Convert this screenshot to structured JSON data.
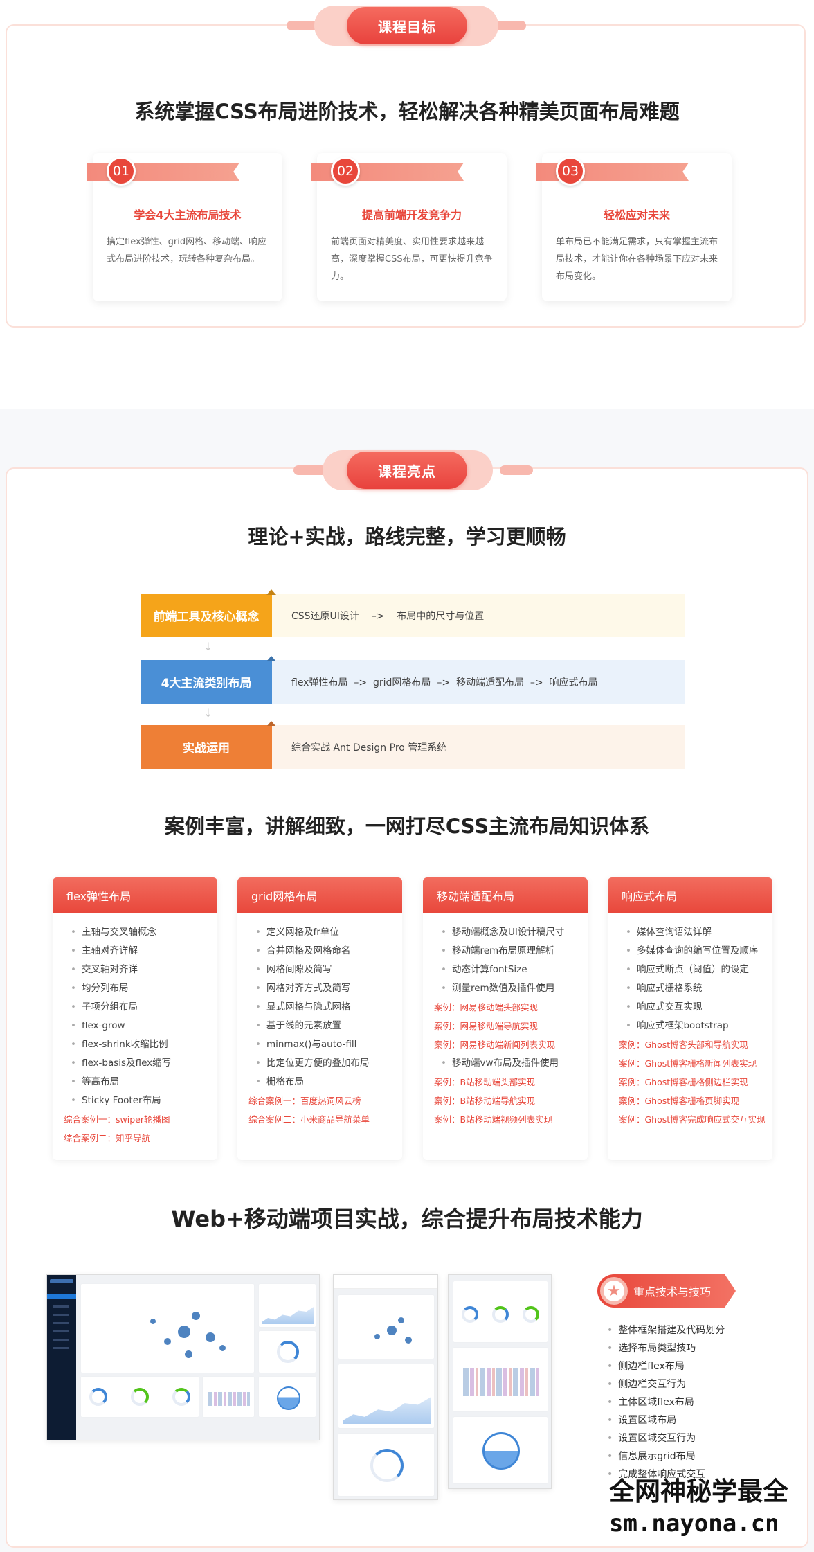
{
  "section1": {
    "badge": "课程目标",
    "heading": "系统掌握CSS布局进阶技术，轻松解决各种精美页面布局难题",
    "goals": [
      {
        "num": "01",
        "title": "学会4大主流布局技术",
        "desc": "搞定flex弹性、grid网格、移动端、响应式布局进阶技术，玩转各种复杂布局。"
      },
      {
        "num": "02",
        "title": "提高前端开发竞争力",
        "desc": "前端页面对精美度、实用性要求越来越高，深度掌握CSS布局，可更快提升竞争力。"
      },
      {
        "num": "03",
        "title": "轻松应对未来",
        "desc": "单布局已不能满足需求，只有掌握主流布局技术，才能让你在各种场景下应对未来布局变化。"
      }
    ]
  },
  "section2": {
    "badge": "课程亮点",
    "heading1": "理论+实战，路线完整，学习更顺畅",
    "route": [
      {
        "label": "前端工具及核心概念",
        "content": "CSS还原UI设计    –>    布局中的尺寸与位置",
        "color": "#f5a41a",
        "bg": "#fef9e9"
      },
      {
        "label": "4大主流类别布局",
        "content": "flex弹性布局  –>  grid网格布局  –>  移动端适配布局  –>  响应式布局",
        "color": "#4a8fd6",
        "bg": "#eaf2fb"
      },
      {
        "label": "实战运用",
        "content": "综合实战 Ant Design Pro 管理系统",
        "color": "#ee7f36",
        "bg": "#fdf3ea"
      }
    ],
    "arrow": "↓",
    "heading2": "案例丰富，讲解细致，一网打尽CSS主流布局知识体系",
    "cases": [
      {
        "title": "flex弹性布局",
        "items": [
          {
            "t": "主轴与交叉轴概念",
            "s": false
          },
          {
            "t": "主轴对齐详解",
            "s": false
          },
          {
            "t": "交叉轴对齐详",
            "s": false
          },
          {
            "t": "均分列布局",
            "s": false
          },
          {
            "t": "子项分组布局",
            "s": false
          },
          {
            "t": "flex-grow",
            "s": false
          },
          {
            "t": "flex-shrink收缩比例",
            "s": false
          },
          {
            "t": "flex-basis及flex缩写",
            "s": false
          },
          {
            "t": "等高布局",
            "s": false
          },
          {
            "t": "Sticky Footer布局",
            "s": false
          },
          {
            "t": "综合案例一：swiper轮播图",
            "s": true
          },
          {
            "t": "综合案例二：知乎导航",
            "s": true
          }
        ]
      },
      {
        "title": "grid网格布局",
        "items": [
          {
            "t": "定义网格及fr单位",
            "s": false
          },
          {
            "t": "合并网格及网格命名",
            "s": false
          },
          {
            "t": "网格间隙及简写",
            "s": false
          },
          {
            "t": "网格对齐方式及简写",
            "s": false
          },
          {
            "t": "显式网格与隐式网格",
            "s": false
          },
          {
            "t": "基于线的元素放置",
            "s": false
          },
          {
            "t": "minmax()与auto-fill",
            "s": false
          },
          {
            "t": "比定位更方便的叠加布局",
            "s": false
          },
          {
            "t": "栅格布局",
            "s": false
          },
          {
            "t": "综合案例一：百度热词风云榜",
            "s": true
          },
          {
            "t": "综合案例二：小米商品导航菜单",
            "s": true
          }
        ]
      },
      {
        "title": "移动端适配布局",
        "items": [
          {
            "t": "移动端概念及UI设计稿尺寸",
            "s": false
          },
          {
            "t": "移动端rem布局原理解析",
            "s": false
          },
          {
            "t": "动态计算fontSize",
            "s": false
          },
          {
            "t": "测量rem数值及插件使用",
            "s": false
          },
          {
            "t": "案例：网易移动端头部实现",
            "s": true
          },
          {
            "t": "案例：网易移动端导航实现",
            "s": true
          },
          {
            "t": "案例：网易移动端新闻列表实现",
            "s": true
          },
          {
            "t": "移动端vw布局及插件使用",
            "s": false
          },
          {
            "t": "案例：B站移动端头部实现",
            "s": true
          },
          {
            "t": "案例：B站移动端导航实现",
            "s": true
          },
          {
            "t": "案例：B站移动端视频列表实现",
            "s": true
          }
        ]
      },
      {
        "title": "响应式布局",
        "items": [
          {
            "t": "媒体查询语法详解",
            "s": false
          },
          {
            "t": "多媒体查询的编写位置及顺序",
            "s": false
          },
          {
            "t": "响应式断点（阈值）的设定",
            "s": false
          },
          {
            "t": "响应式栅格系统",
            "s": false
          },
          {
            "t": "响应式交互实现",
            "s": false
          },
          {
            "t": "响应式框架bootstrap",
            "s": false
          },
          {
            "t": "案例：Ghost博客头部和导航实现",
            "s": true
          },
          {
            "t": "案例：Ghost博客栅格新闻列表实现",
            "s": true
          },
          {
            "t": "案例：Ghost博客栅格侧边栏实现",
            "s": true
          },
          {
            "t": "案例：Ghost博客栅格页脚实现",
            "s": true
          },
          {
            "t": "案例：Ghost博客完成响应式交互实现",
            "s": true
          }
        ]
      }
    ],
    "heading3": "Web+移动端项目实战，综合提升布局技术能力",
    "highlights_title": "重点技术与技巧",
    "highlights": [
      "整体框架搭建及代码划分",
      "选择布局类型技巧",
      "侧边栏flex布局",
      "侧边栏交互行为",
      "主体区域flex布局",
      "设置区域布局",
      "设置区域交互行为",
      "信息展示grid布局",
      "完成整体响应式交互"
    ]
  },
  "watermark": {
    "line1": "全网神秘学最全",
    "line2": "sm.nayona.cn"
  }
}
